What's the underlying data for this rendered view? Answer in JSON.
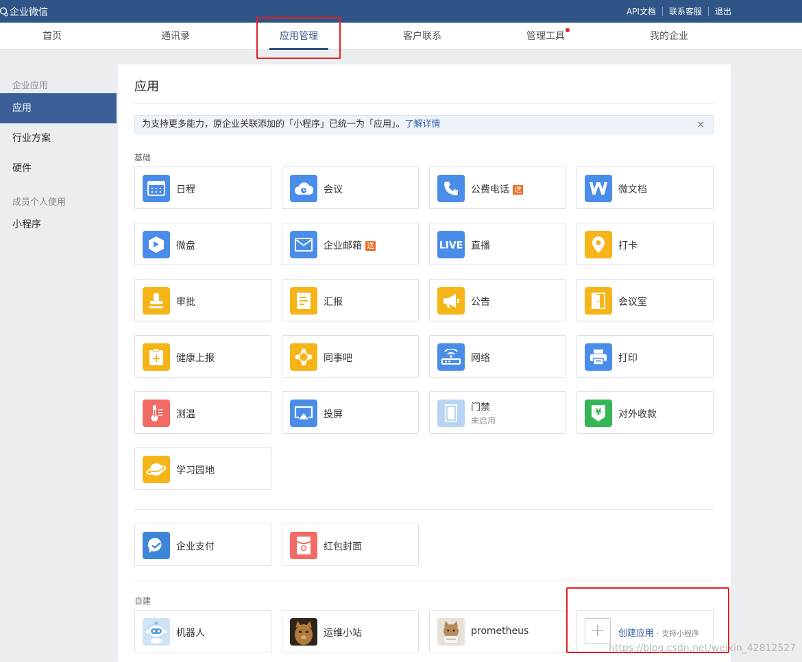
{
  "topbar": {
    "brand": "企业微信",
    "links": [
      "API文档",
      "联系客服",
      "退出"
    ]
  },
  "nav": {
    "items": [
      "首页",
      "通讯录",
      "应用管理",
      "客户联系",
      "管理工具",
      "我的企业"
    ],
    "active": "应用管理"
  },
  "sidebar": {
    "group1": "企业应用",
    "items1": [
      "应用",
      "行业方案",
      "硬件"
    ],
    "group2": "成员个人使用",
    "items2": [
      "小程序"
    ]
  },
  "main": {
    "title": "应用",
    "notice": "为支持更多能力，原企业关联添加的「小程序」已统一为「应用」。",
    "notice_link": "了解详情",
    "notice_close": "×",
    "section_basic": "基础",
    "basic_apps": [
      {
        "name": "日程",
        "icon": "calendar-icon"
      },
      {
        "name": "会议",
        "icon": "meeting-cloud-icon"
      },
      {
        "name": "公费电话",
        "badge": "送",
        "icon": "phone-icon"
      },
      {
        "name": "微文档",
        "icon": "doc-w-icon"
      },
      {
        "name": "微盘",
        "icon": "drive-icon"
      },
      {
        "name": "企业邮箱",
        "badge": "送",
        "icon": "mail-icon"
      },
      {
        "name": "直播",
        "icon": "live-icon"
      },
      {
        "name": "打卡",
        "icon": "location-pin-icon"
      },
      {
        "name": "审批",
        "icon": "stamp-icon"
      },
      {
        "name": "汇报",
        "icon": "report-icon"
      },
      {
        "name": "公告",
        "icon": "megaphone-icon"
      },
      {
        "name": "会议室",
        "icon": "door-icon"
      },
      {
        "name": "健康上报",
        "icon": "health-report-icon"
      },
      {
        "name": "同事吧",
        "icon": "community-icon"
      },
      {
        "name": "网络",
        "icon": "wifi-router-icon"
      },
      {
        "name": "打印",
        "icon": "printer-icon"
      },
      {
        "name": "测温",
        "icon": "thermometer-icon"
      },
      {
        "name": "投屏",
        "icon": "screencast-icon"
      },
      {
        "name": "门禁",
        "sub": "未启用",
        "icon": "access-door-icon"
      },
      {
        "name": "对外收款",
        "icon": "payment-yuan-icon"
      },
      {
        "name": "学习园地",
        "icon": "planet-icon"
      }
    ],
    "extra_apps": [
      {
        "name": "企业支付",
        "icon": "pay-icon"
      },
      {
        "name": "红包封面",
        "icon": "red-envelope-icon"
      }
    ],
    "section_custom": "自建",
    "custom_apps": [
      {
        "name": "机器人",
        "icon": "robot-icon"
      },
      {
        "name": "运维小站",
        "icon": "cat-photo-icon"
      },
      {
        "name": "prometheus",
        "icon": "cat-sign-photo-icon"
      }
    ],
    "create": {
      "label": "创建应用",
      "sub": "· 支持小程序",
      "icon": "plus-icon"
    }
  },
  "watermark": "https://blog.csdn.net/weixin_42812527"
}
